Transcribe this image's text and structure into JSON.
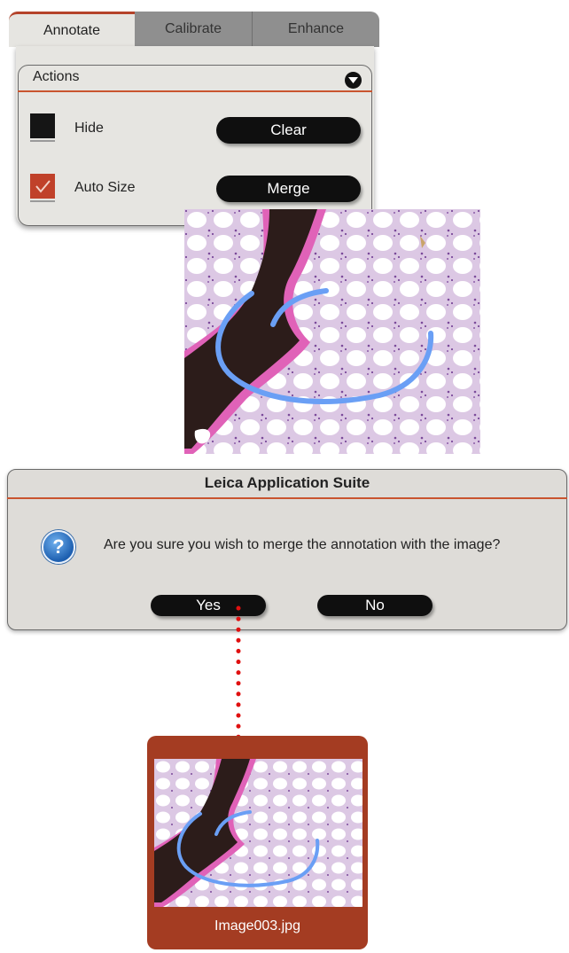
{
  "tabs": [
    {
      "label": "Annotate",
      "active": true
    },
    {
      "label": "Calibrate",
      "active": false
    },
    {
      "label": "Enhance",
      "active": false
    }
  ],
  "actions": {
    "title": "Actions",
    "hide_label": "Hide",
    "auto_size_label": "Auto Size",
    "hide_checked": false,
    "auto_size_checked": true,
    "clear_button": "Clear",
    "merge_button": "Merge"
  },
  "dialog": {
    "title": "Leica Application Suite",
    "message": "Are you sure you wish to merge the annotation with the image?",
    "yes_button": "Yes",
    "no_button": "No"
  },
  "thumbnail": {
    "filename": "Image003.jpg"
  },
  "colors": {
    "accent": "#c9542f",
    "thumbnail_frame": "#a43c22",
    "annotation": "#6a9ff5",
    "connector": "#e01010"
  }
}
